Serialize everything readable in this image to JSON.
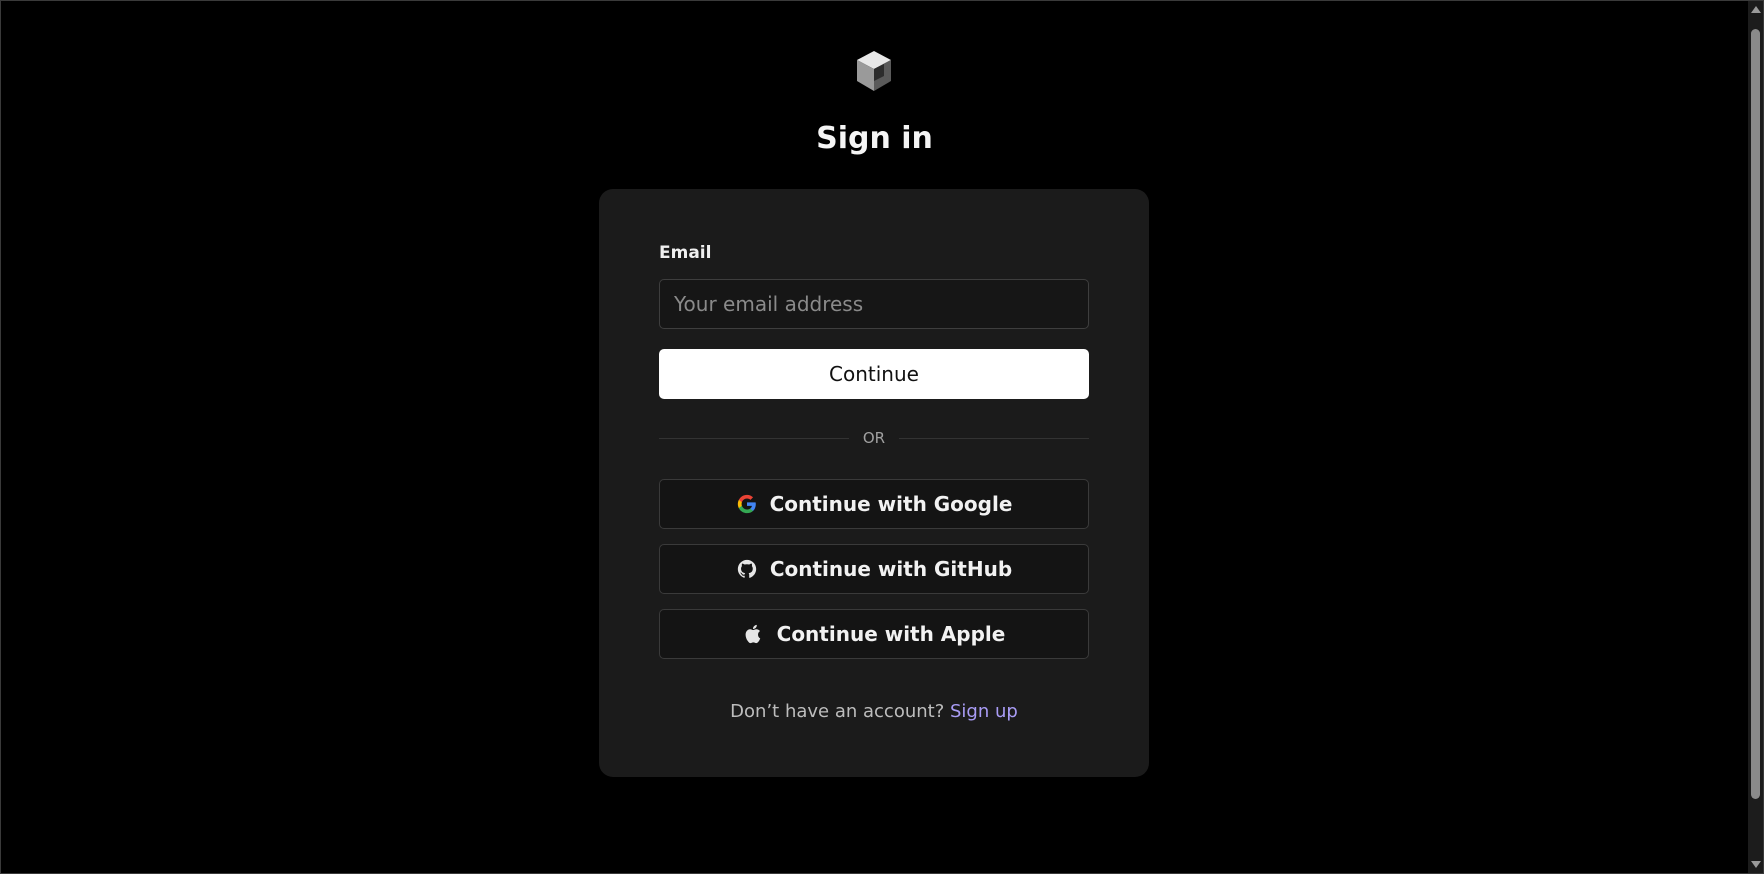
{
  "page": {
    "title": "Sign in"
  },
  "form": {
    "email_label": "Email",
    "email_value": "",
    "email_placeholder": "Your email address",
    "continue_label": "Continue",
    "divider_text": "OR"
  },
  "oauth": {
    "google_label": "Continue with Google",
    "github_label": "Continue with GitHub",
    "apple_label": "Continue with Apple"
  },
  "signup": {
    "prompt": "Don’t have an account?",
    "link_label": "Sign up"
  },
  "colors": {
    "background": "#000000",
    "card": "#1b1b1b",
    "primary_button": "#ffffff",
    "link": "#a99cf5"
  },
  "icons": {
    "logo": "cube-logo-icon",
    "google": "google-icon",
    "github": "github-icon",
    "apple": "apple-icon"
  }
}
